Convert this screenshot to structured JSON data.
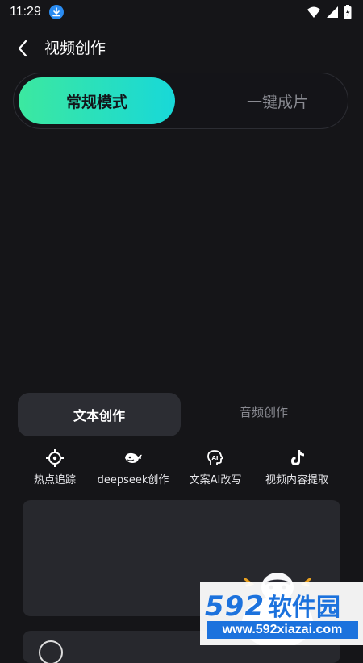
{
  "status_bar": {
    "time": "11:29",
    "icons": [
      "download-icon",
      "wifi-icon",
      "signal-icon",
      "battery-icon"
    ]
  },
  "header": {
    "title": "视频创作",
    "back_icon": "chevron-left-icon"
  },
  "mode_tabs": {
    "active": "常规模式",
    "inactive": "一键成片"
  },
  "sub_tabs": {
    "active": "文本创作",
    "inactive": "音频创作"
  },
  "tools": [
    {
      "label": "热点追踪",
      "icon": "crosshair-icon"
    },
    {
      "label": "deepseek创作",
      "icon": "whale-icon"
    },
    {
      "label": "文案AI改写",
      "icon": "ai-head-icon"
    },
    {
      "label": "视频内容提取",
      "icon": "tiktok-icon"
    }
  ],
  "watermark": {
    "number": "592",
    "brand": "软件园",
    "url": "www.592xiazai.com"
  },
  "colors": {
    "accent_start": "#3ce8a0",
    "accent_end": "#18d8d8",
    "background": "#151518",
    "card": "#27282d",
    "watermark_blue": "#1c72dd"
  }
}
